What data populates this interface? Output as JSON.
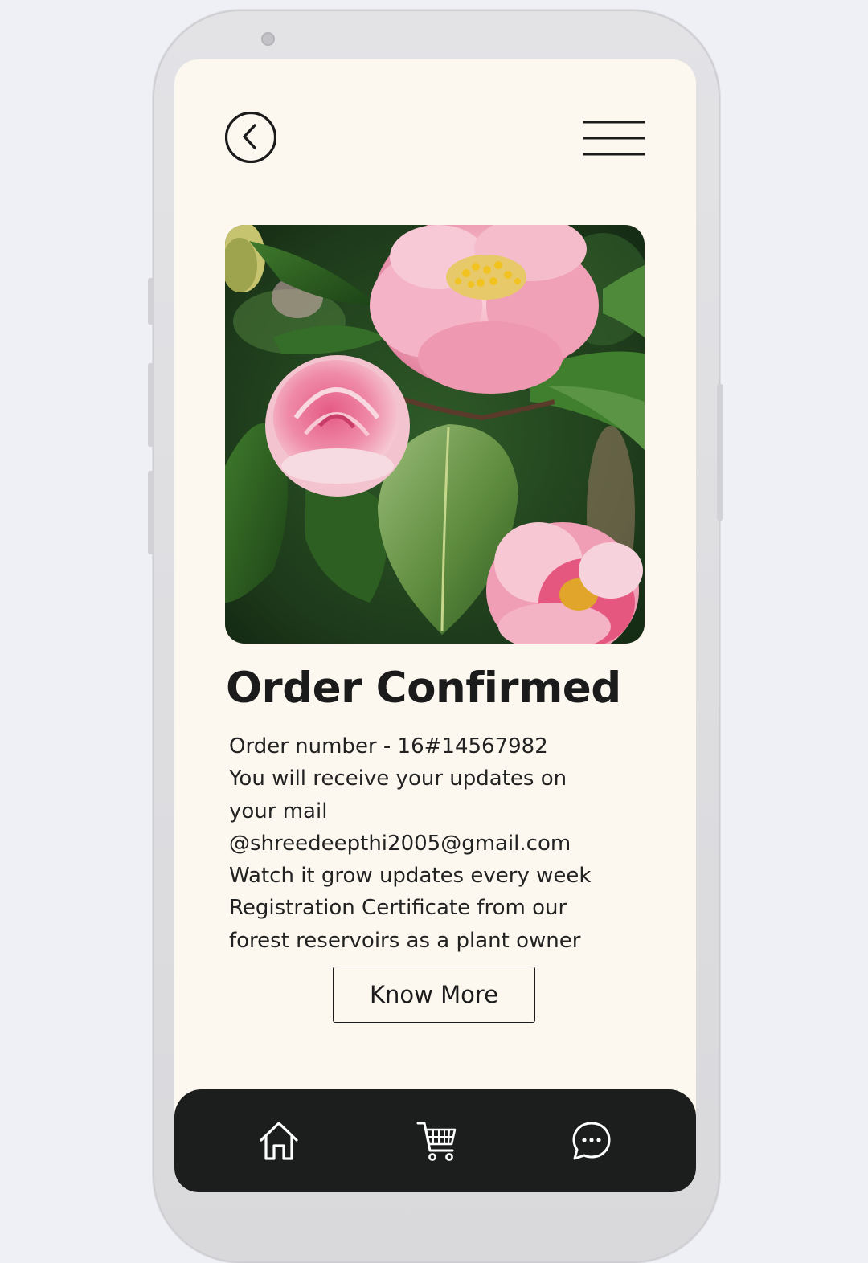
{
  "header": {
    "back_icon": "chevron-left-circle-icon",
    "menu_icon": "hamburger-menu-icon"
  },
  "product_image": {
    "subject": "pink camellia flowers with green leaves"
  },
  "order": {
    "title": "Order Confirmed",
    "lines": [
      "Order number - 16#14567982",
      "You will receive your updates on",
      "your mail",
      "@shreedeepthi2005@gmail.com",
      "Watch it grow updates every week",
      "Registration Certificate from our",
      "forest reservoirs as a plant owner"
    ],
    "button_label": "Know More"
  },
  "bottom_nav": {
    "items": [
      {
        "icon": "home-icon"
      },
      {
        "icon": "cart-icon"
      },
      {
        "icon": "chat-icon"
      }
    ]
  },
  "colors": {
    "screen_background": "#fdf8ef",
    "text": "#1b1b1b",
    "nav_background": "#1c1e1d",
    "nav_icon": "#ffffff"
  }
}
